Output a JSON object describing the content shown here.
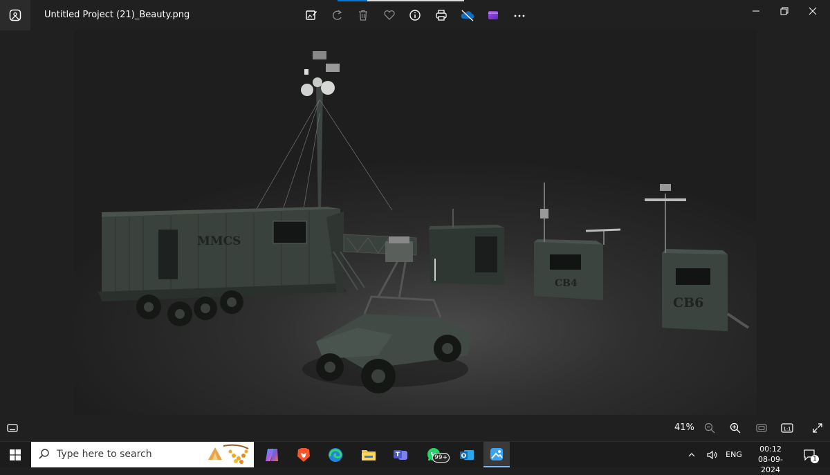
{
  "window": {
    "title": "Untitled Project (21)_Beauty.png"
  },
  "toolbar": {
    "buttons": [
      "edit-image-icon",
      "rotate-icon",
      "delete-icon",
      "favorite-icon",
      "info-icon",
      "print-icon",
      "onedrive-icon",
      "clipchamp-icon",
      "more-icon"
    ]
  },
  "scene": {
    "labels": {
      "trailer": "MMCS",
      "box1": "CB4",
      "box2": "CB6"
    }
  },
  "status": {
    "zoom": "41%"
  },
  "taskbar": {
    "search_placeholder": "Type here to search",
    "whatsapp_badge": "99+",
    "language": "ENG",
    "time": "00:12",
    "date": "08-09-2024",
    "notification_count": "1"
  },
  "colors": {
    "accent": "#0078d4",
    "background": "#202020",
    "taskbar": "#1c1c1c"
  }
}
